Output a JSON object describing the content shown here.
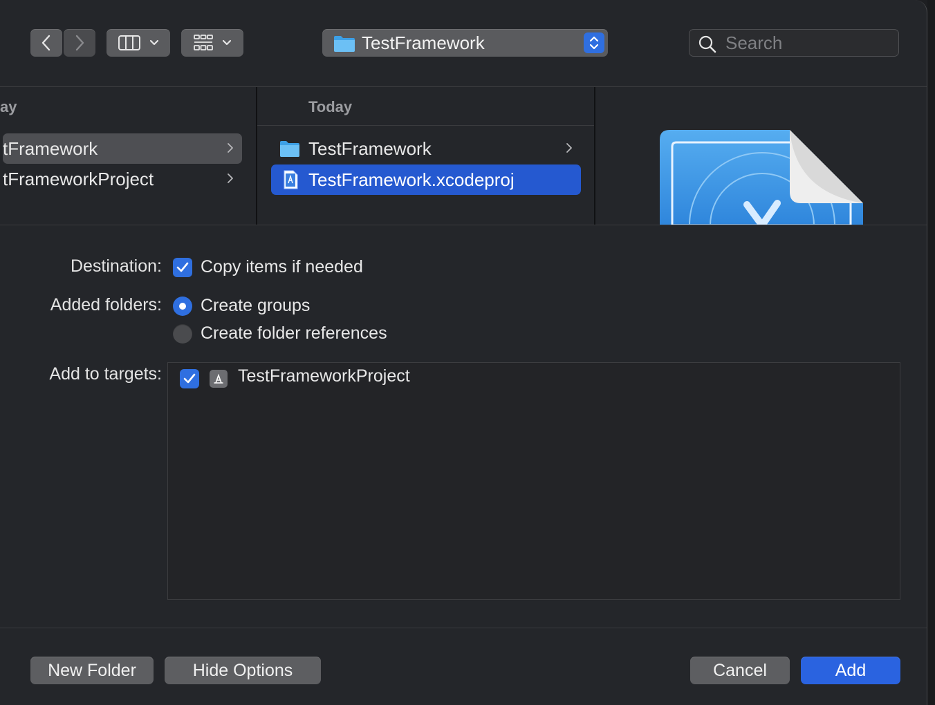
{
  "toolbar": {
    "path_popup_label": "TestFramework",
    "search_placeholder": "Search"
  },
  "browser": {
    "col1": {
      "header": "ay",
      "items": [
        {
          "label": "tFramework",
          "selected": true
        },
        {
          "label": "tFrameworkProject",
          "selected": false
        }
      ]
    },
    "col2": {
      "header": "Today",
      "items": [
        {
          "label": "TestFramework",
          "icon": "folder-icon",
          "has_children": true
        },
        {
          "label": "TestFramework.xcodeproj",
          "icon": "xcodeproj-file-icon",
          "selected": true
        }
      ]
    },
    "preview_icon": "xcode-project-document-icon"
  },
  "options": {
    "destination_label": "Destination:",
    "copy_items_label": "Copy items if needed",
    "copy_items_checked": true,
    "added_folders_label": "Added folders:",
    "create_groups_label": "Create groups",
    "create_folder_refs_label": "Create folder references",
    "selected_folder_option": "Create groups",
    "add_to_targets_label": "Add to targets:",
    "targets": [
      {
        "name": "TestFrameworkProject",
        "checked": true,
        "icon": "app-target-icon"
      }
    ]
  },
  "buttons": {
    "new_folder": "New Folder",
    "hide_options": "Hide Options",
    "cancel": "Cancel",
    "add": "Add"
  },
  "colors": {
    "accent": "#2f6fe0",
    "selection": "#2559d0",
    "window_bg": "#24262a"
  }
}
